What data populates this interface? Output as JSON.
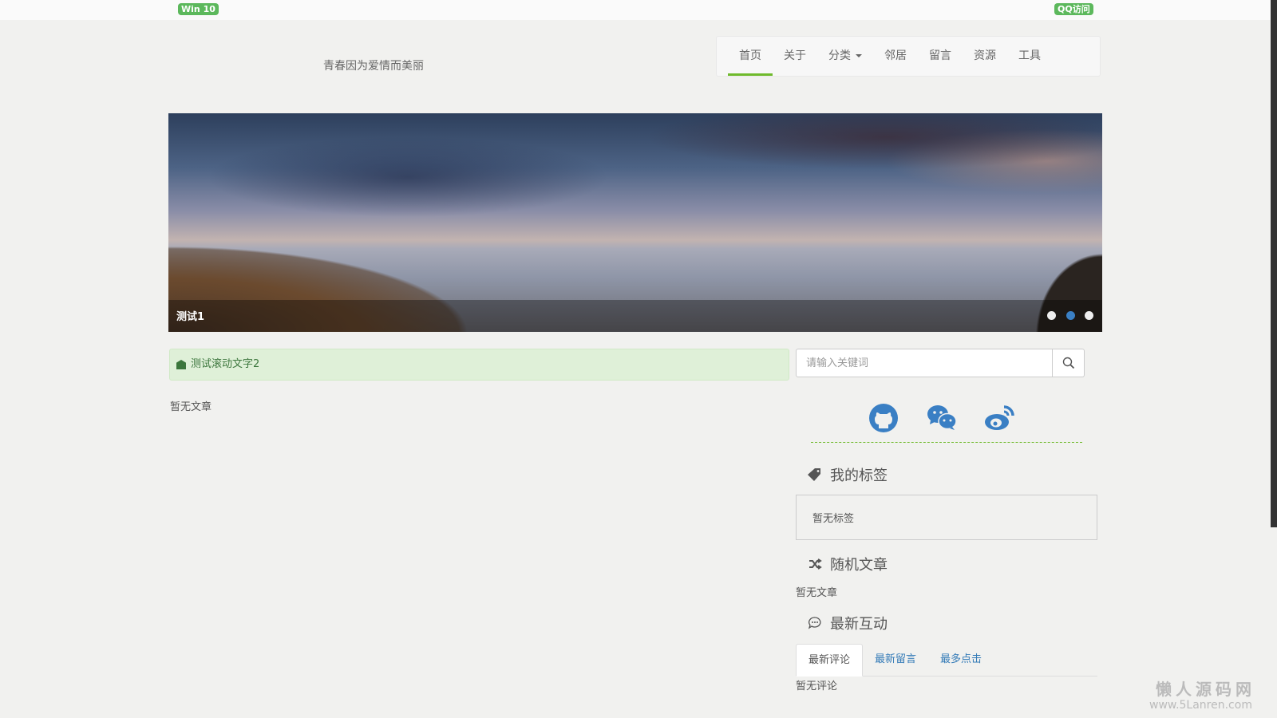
{
  "topbar": {
    "os_badge": "Win 10",
    "browser_badge": "QQ访问"
  },
  "header": {
    "slogan": "青春因为爱情而美丽"
  },
  "nav": {
    "items": [
      {
        "label": "首页",
        "active": true
      },
      {
        "label": "关于"
      },
      {
        "label": "分类",
        "dropdown": true
      },
      {
        "label": "邻居"
      },
      {
        "label": "留言"
      },
      {
        "label": "资源"
      },
      {
        "label": "工具"
      }
    ]
  },
  "banner": {
    "caption": "测试1",
    "slides": 3,
    "active_slide": 2
  },
  "notice": {
    "text": "测试滚动文字2"
  },
  "main": {
    "empty_text": "暂无文章"
  },
  "search": {
    "placeholder": "请输入关键词"
  },
  "social": [
    "github-icon",
    "wechat-icon",
    "weibo-icon"
  ],
  "colors": {
    "accent": "#6fba2c",
    "social": "#3a7fc4",
    "badge": "#5cb85c"
  },
  "widgets": {
    "tags": {
      "title": "我的标签",
      "empty": "暂无标签"
    },
    "random": {
      "title": "随机文章",
      "empty": "暂无文章"
    },
    "interact": {
      "title": "最新互动",
      "tabs": [
        "最新评论",
        "最新留言",
        "最多点击"
      ],
      "empty": "暂无评论"
    }
  },
  "watermark": {
    "name": "懒人源码网",
    "url": "www.5Lanren.com"
  }
}
